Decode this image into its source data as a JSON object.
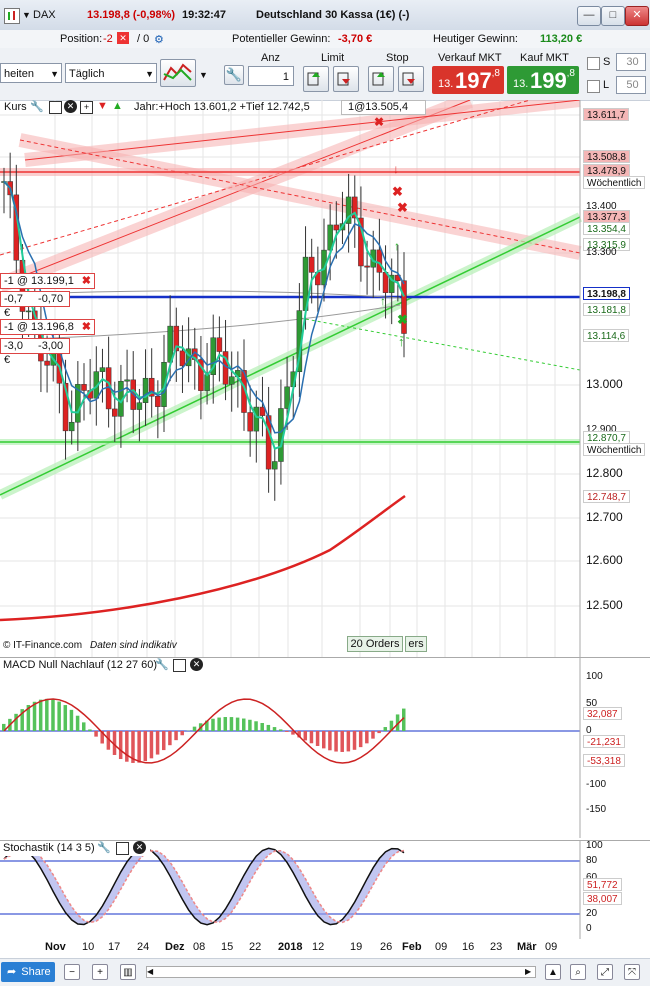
{
  "titlebar": {
    "symbol": "DAX",
    "change": "13.198,8 (-0,98%)",
    "time": "19:32:47",
    "instrument": "Deutschland 30 Kassa (1€) (-)",
    "btn_min": "—",
    "btn_max": "□",
    "btn_close": "✕"
  },
  "posbar": {
    "position_label": "Position:",
    "position_value": "-2",
    "position_zero": "/ 0",
    "potential_label": "Potentieller Gewinn:",
    "potential_value": "-3,70 €",
    "today_label": "Heutiger Gewinn:",
    "today_value": "113,20 €"
  },
  "toolbar": {
    "period_select": "heiten",
    "interval_select": "Täglich",
    "anz_label": "Anz",
    "anz_value": "1",
    "limit_label": "Limit",
    "stop_label": "Stop",
    "sell_label": "Verkauf MKT",
    "buy_label": "Kauf MKT",
    "sell_small": "13.",
    "sell_big": "197",
    "sell_tiny": ",8",
    "buy_small": "13.",
    "buy_big": "199",
    "buy_tiny": ",8",
    "s_label": "S",
    "s_value": "30",
    "l_label": "L",
    "l_value": "50"
  },
  "chart": {
    "header_kurs": "Kurs",
    "header_info": "Jahr:+Hoch 13.601,2 +Tief 12.742,5",
    "order_top": "1@13.505,4",
    "order1": "-1 @ 13.199,1",
    "order1_pnl_a": "-0,7",
    "order1_pnl_b": "-0,70 €",
    "order2": "-1 @ 13.196,8",
    "order2_pnl_a": "-3,0",
    "order2_pnl_b": "-3,00 €",
    "footer_source": "© IT-Finance.com",
    "footer_note": "Daten sind indikativ",
    "orders_tab": "20 Orders",
    "orders_tab2": "ers",
    "price_axis": [
      {
        "text": "13.611,7",
        "bg": "#f4b6b6"
      },
      {
        "text": "13.508,8",
        "bg": "#f4b6b6"
      },
      {
        "text": "13.478,9",
        "bg": "#f4b6b6"
      },
      {
        "text": "Wöchentlich",
        "bg": "#ffffff"
      },
      {
        "text": "13.400",
        "bg": "none"
      },
      {
        "text": "13.377,3",
        "bg": "#f4b6b6"
      },
      {
        "text": "13.354,4",
        "bg": "#ffffff"
      },
      {
        "text": "13.315,9",
        "bg": "#ffffff"
      },
      {
        "text": "13.300",
        "bg": "none"
      },
      {
        "text": "13.198,8",
        "bg": "#ffffff"
      },
      {
        "text": "13.181,8",
        "bg": "#ffffff"
      },
      {
        "text": "13.114,6",
        "bg": "#ffffff"
      },
      {
        "text": "13.000",
        "bg": "none"
      },
      {
        "text": "12.900",
        "bg": "none"
      },
      {
        "text": "12.870,7",
        "bg": "#ffffff"
      },
      {
        "text": "Wöchentlich",
        "bg": "#ffffff"
      },
      {
        "text": "12.800",
        "bg": "none"
      },
      {
        "text": "12.748,7",
        "bg": "#ffffff"
      },
      {
        "text": "12.700",
        "bg": "none"
      },
      {
        "text": "12.600",
        "bg": "none"
      },
      {
        "text": "12.500",
        "bg": "none"
      }
    ]
  },
  "macd": {
    "title": "MACD Null Nachlauf (12 27 60)",
    "axis": [
      "100",
      "50",
      "32,087",
      "0",
      "-21,231",
      "-53,318",
      "-100",
      "-150"
    ]
  },
  "stoch": {
    "title": "Stochastik (14 3 5)",
    "axis": [
      "100",
      "80",
      "60",
      "51,772",
      "38,007",
      "20",
      "0"
    ]
  },
  "xaxis": [
    "Nov",
    "10",
    "17",
    "24",
    "Dez",
    "08",
    "15",
    "22",
    "2018",
    "12",
    "19",
    "26",
    "Feb",
    "09",
    "16",
    "23",
    "Mär",
    "09"
  ],
  "bottombar": {
    "share": "Share"
  },
  "chart_data": {
    "type": "candlestick",
    "title": "DAX",
    "period": "Täglich",
    "ylim": [
      12450,
      13680
    ],
    "ohlc_close_approx": [
      {
        "x": "Nov",
        "close": 13470
      },
      {
        "x": "10",
        "close": 13130
      },
      {
        "x": "17",
        "close": 13000
      },
      {
        "x": "24",
        "close": 13060
      },
      {
        "x": "Dez",
        "close": 13000
      },
      {
        "x": "08",
        "close": 13120
      },
      {
        "x": "15",
        "close": 13100
      },
      {
        "x": "22",
        "close": 13070
      },
      {
        "x": "2018",
        "close": 12870
      },
      {
        "x": "12",
        "close": 13250
      },
      {
        "x": "19",
        "close": 13430
      },
      {
        "x": "26",
        "close": 13340
      },
      {
        "x": "Feb",
        "close": 13198.8
      }
    ]
  }
}
